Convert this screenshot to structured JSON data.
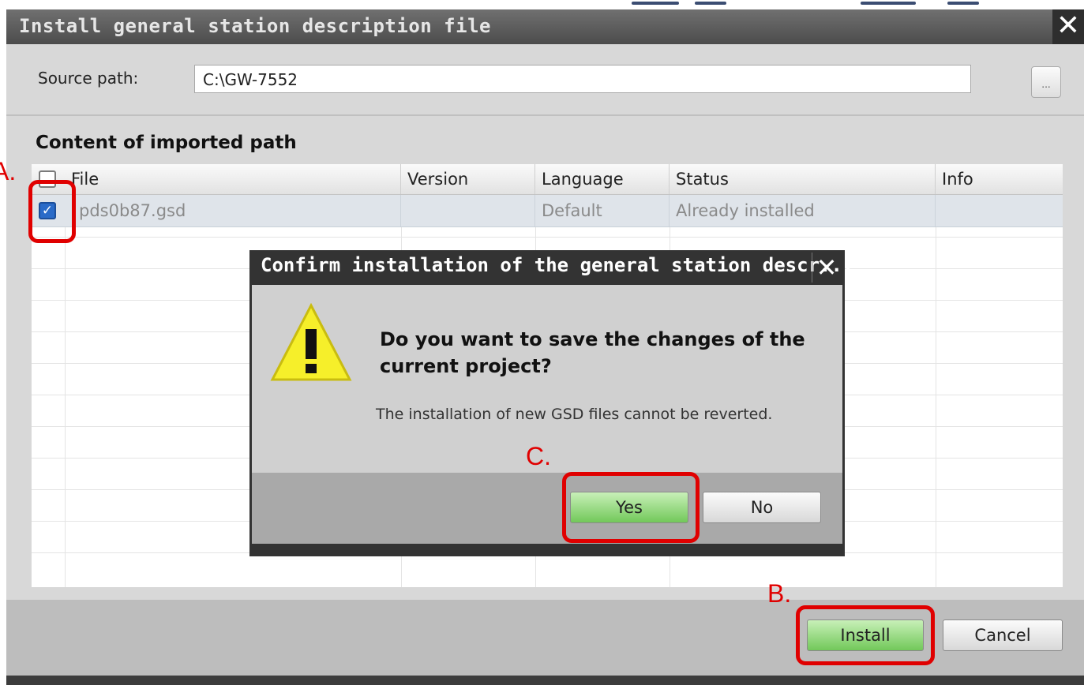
{
  "dialog": {
    "title": "Install general station description file",
    "close_symbol": "✕",
    "source_label": "Source path:",
    "source_value": "C:\\GW-7552",
    "browse_label": "...",
    "section_title": "Content of imported path",
    "columns": [
      "File",
      "Version",
      "Language",
      "Status",
      "Info"
    ],
    "rows": [
      {
        "checked": true,
        "file": "pds0b87.gsd",
        "version": "",
        "language": "Default",
        "status": "Already installed",
        "info": ""
      }
    ],
    "install_label": "Install",
    "cancel_label": "Cancel"
  },
  "confirm": {
    "title": "Confirm installation of the general station descr...",
    "close_symbol": "✕",
    "icon": "warning-icon",
    "question": "Do you want to save the changes of the current project?",
    "detail": "The installation of new GSD files cannot be reverted.",
    "yes_label": "Yes",
    "no_label": "No"
  },
  "annotations": {
    "a": "A.",
    "b": "B.",
    "c": "C."
  },
  "colors": {
    "highlight": "#e00000",
    "primary_button": "#72c85a",
    "checkbox": "#2a6bc8"
  }
}
